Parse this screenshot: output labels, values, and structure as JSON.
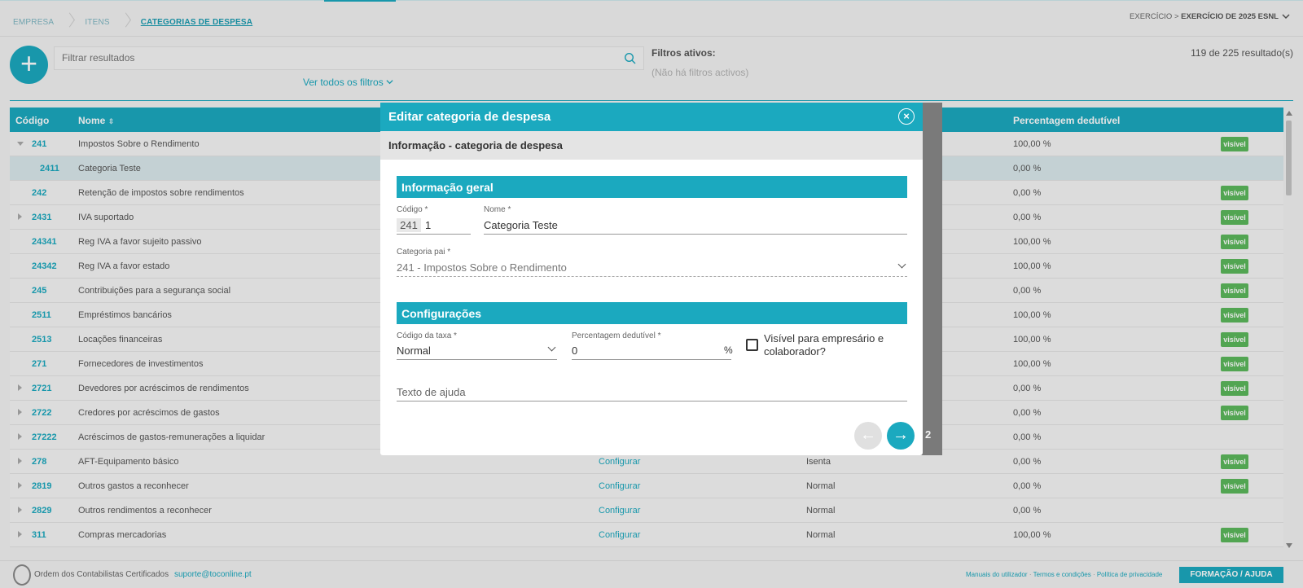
{
  "breadcrumb": {
    "items": [
      "EMPRESA",
      "ITENS",
      "CATEGORIAS DE DESPESA"
    ]
  },
  "exercise": {
    "label": "EXERCÍCIO >",
    "value": "EXERCÍCIO DE 2025 ESNL"
  },
  "toolbar": {
    "add_label": "+",
    "search_placeholder": "Filtrar resultados",
    "all_filters": "Ver todos os filtros",
    "filters_title": "Filtros ativos:",
    "filters_none": "(Não há filtros activos)",
    "results": "119 de 225 resultado(s)"
  },
  "table": {
    "headers": {
      "codigo": "Código",
      "nome": "Nome",
      "percentagem": "Percentagem dedutível"
    },
    "rows": [
      {
        "expander": "open",
        "code": "241",
        "name": "Impostos Sobre o Rendimento",
        "config": "",
        "tax": "",
        "percent": "100,00 %",
        "badge": "visível",
        "selected": false
      },
      {
        "expander": "none",
        "code": "2411",
        "name": "Categoria Teste",
        "config": "",
        "tax": "",
        "percent": "0,00 %",
        "badge": "",
        "selected": true
      },
      {
        "expander": "none",
        "code": "242",
        "name": "Retenção de impostos sobre rendimentos",
        "config": "",
        "tax": "",
        "percent": "0,00 %",
        "badge": "visível",
        "selected": false
      },
      {
        "expander": "closed",
        "code": "2431",
        "name": "IVA suportado",
        "config": "",
        "tax": "",
        "percent": "0,00 %",
        "badge": "visível",
        "selected": false
      },
      {
        "expander": "none",
        "code": "24341",
        "name": "Reg IVA a favor sujeito passivo",
        "config": "",
        "tax": "",
        "percent": "100,00 %",
        "badge": "visível",
        "selected": false
      },
      {
        "expander": "none",
        "code": "24342",
        "name": "Reg IVA a favor estado",
        "config": "",
        "tax": "",
        "percent": "100,00 %",
        "badge": "visível",
        "selected": false
      },
      {
        "expander": "none",
        "code": "245",
        "name": "Contribuições para a segurança social",
        "config": "",
        "tax": "",
        "percent": "0,00 %",
        "badge": "visível",
        "selected": false
      },
      {
        "expander": "none",
        "code": "2511",
        "name": "Empréstimos bancários",
        "config": "",
        "tax": "",
        "percent": "100,00 %",
        "badge": "visível",
        "selected": false
      },
      {
        "expander": "none",
        "code": "2513",
        "name": "Locações financeiras",
        "config": "",
        "tax": "",
        "percent": "100,00 %",
        "badge": "visível",
        "selected": false
      },
      {
        "expander": "none",
        "code": "271",
        "name": "Fornecedores de investimentos",
        "config": "",
        "tax": "",
        "percent": "100,00 %",
        "badge": "visível",
        "selected": false
      },
      {
        "expander": "closed",
        "code": "2721",
        "name": "Devedores por acréscimos de rendimentos",
        "config": "",
        "tax": "",
        "percent": "0,00 %",
        "badge": "visível",
        "selected": false
      },
      {
        "expander": "closed",
        "code": "2722",
        "name": "Credores por acréscimos de gastos",
        "config": "",
        "tax": "",
        "percent": "0,00 %",
        "badge": "visível",
        "selected": false
      },
      {
        "expander": "closed",
        "code": "27222",
        "name": "Acréscimos de gastos-remunerações a liquidar",
        "config": "",
        "tax": "",
        "percent": "0,00 %",
        "badge": "",
        "selected": false
      },
      {
        "expander": "closed",
        "code": "278",
        "name": "AFT-Equipamento básico",
        "config": "Configurar",
        "tax": "Isenta",
        "percent": "0,00 %",
        "badge": "visível",
        "selected": false
      },
      {
        "expander": "closed",
        "code": "2819",
        "name": "Outros gastos a reconhecer",
        "config": "Configurar",
        "tax": "Normal",
        "percent": "0,00 %",
        "badge": "visível",
        "selected": false
      },
      {
        "expander": "closed",
        "code": "2829",
        "name": "Outros rendimentos a reconhecer",
        "config": "Configurar",
        "tax": "Normal",
        "percent": "0,00 %",
        "badge": "",
        "selected": false
      },
      {
        "expander": "closed",
        "code": "311",
        "name": "Compras mercadorias",
        "config": "Configurar",
        "tax": "Normal",
        "percent": "100,00 %",
        "badge": "visível",
        "selected": false
      }
    ]
  },
  "modal": {
    "title": "Editar categoria de despesa",
    "close_icon": "×",
    "subtitle": "Informação - categoria de despesa",
    "section_general": "Informação geral",
    "codigo_label": "Código *",
    "codigo_prefix": "241",
    "codigo_value": "1",
    "nome_label": "Nome *",
    "nome_value": "Categoria Teste",
    "categoria_pai_label": "Categoria pai *",
    "categoria_pai_value": "241 - Impostos Sobre o Rendimento",
    "section_config": "Configurações",
    "taxa_label": "Código da taxa *",
    "taxa_value": "Normal",
    "percent_label": "Percentagem dedutível *",
    "percent_value": "0",
    "percent_unit": "%",
    "visivel_label_1": "Visível para empresário e",
    "visivel_label_2": "colaborador?",
    "help_placeholder": "Texto de ajuda",
    "prev_icon": "←",
    "next_icon": "→",
    "page_number": "2"
  },
  "footer": {
    "occ": "Ordem dos Contabilistas Certificados",
    "support": "suporte@toconline.pt",
    "links": [
      "Manuais do utilizador",
      "Termos e condições",
      "Política de privacidade"
    ],
    "train_button": "FORMAÇÃO / AJUDA"
  },
  "colors": {
    "accent": "#1ba9bf",
    "badge": "#5cb85c"
  }
}
